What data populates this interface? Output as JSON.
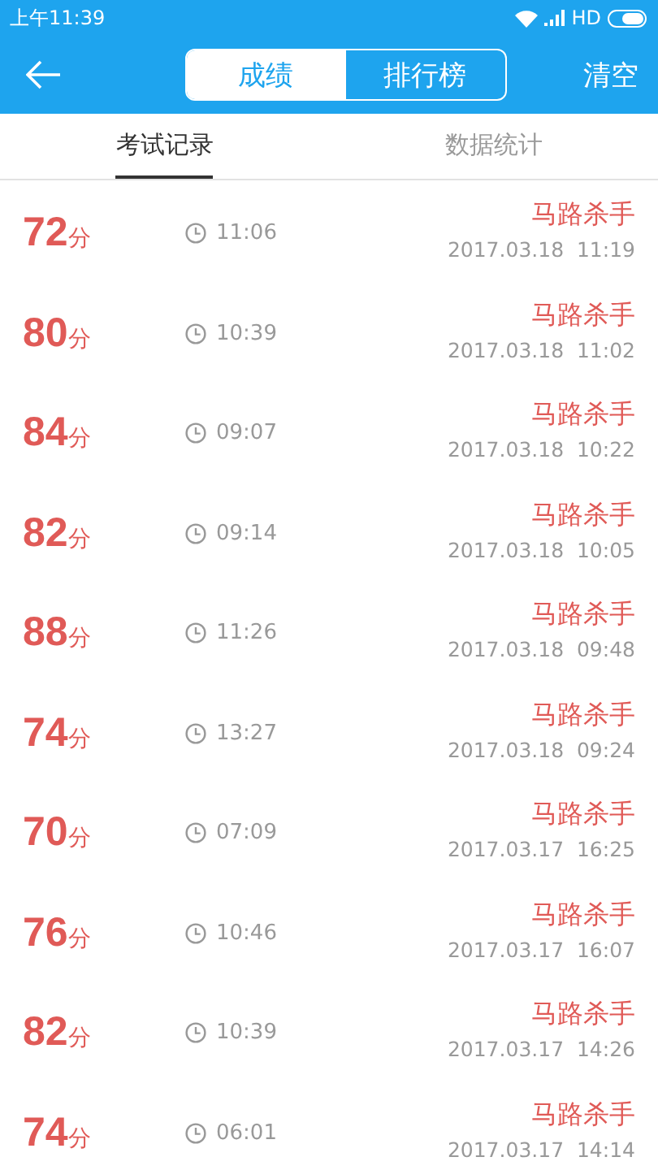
{
  "status_bar": {
    "time": "上午11:39",
    "network": "HD"
  },
  "header": {
    "segments": [
      {
        "label": "成绩",
        "selected": true
      },
      {
        "label": "排行榜",
        "selected": false
      }
    ],
    "action": "清空"
  },
  "tabs": [
    {
      "label": "考试记录",
      "selected": true
    },
    {
      "label": "数据统计",
      "selected": false
    }
  ],
  "records": [
    {
      "score": "72",
      "unit": "分",
      "duration": "11:06",
      "name": "马路杀手",
      "date": "2017.03.18  11:19"
    },
    {
      "score": "80",
      "unit": "分",
      "duration": "10:39",
      "name": "马路杀手",
      "date": "2017.03.18  11:02"
    },
    {
      "score": "84",
      "unit": "分",
      "duration": "09:07",
      "name": "马路杀手",
      "date": "2017.03.18  10:22"
    },
    {
      "score": "82",
      "unit": "分",
      "duration": "09:14",
      "name": "马路杀手",
      "date": "2017.03.18  10:05"
    },
    {
      "score": "88",
      "unit": "分",
      "duration": "11:26",
      "name": "马路杀手",
      "date": "2017.03.18  09:48"
    },
    {
      "score": "74",
      "unit": "分",
      "duration": "13:27",
      "name": "马路杀手",
      "date": "2017.03.18  09:24"
    },
    {
      "score": "70",
      "unit": "分",
      "duration": "07:09",
      "name": "马路杀手",
      "date": "2017.03.17  16:25"
    },
    {
      "score": "76",
      "unit": "分",
      "duration": "10:46",
      "name": "马路杀手",
      "date": "2017.03.17  16:07"
    },
    {
      "score": "82",
      "unit": "分",
      "duration": "10:39",
      "name": "马路杀手",
      "date": "2017.03.17  14:26"
    },
    {
      "score": "74",
      "unit": "分",
      "duration": "06:01",
      "name": "马路杀手",
      "date": "2017.03.17  14:14"
    }
  ]
}
